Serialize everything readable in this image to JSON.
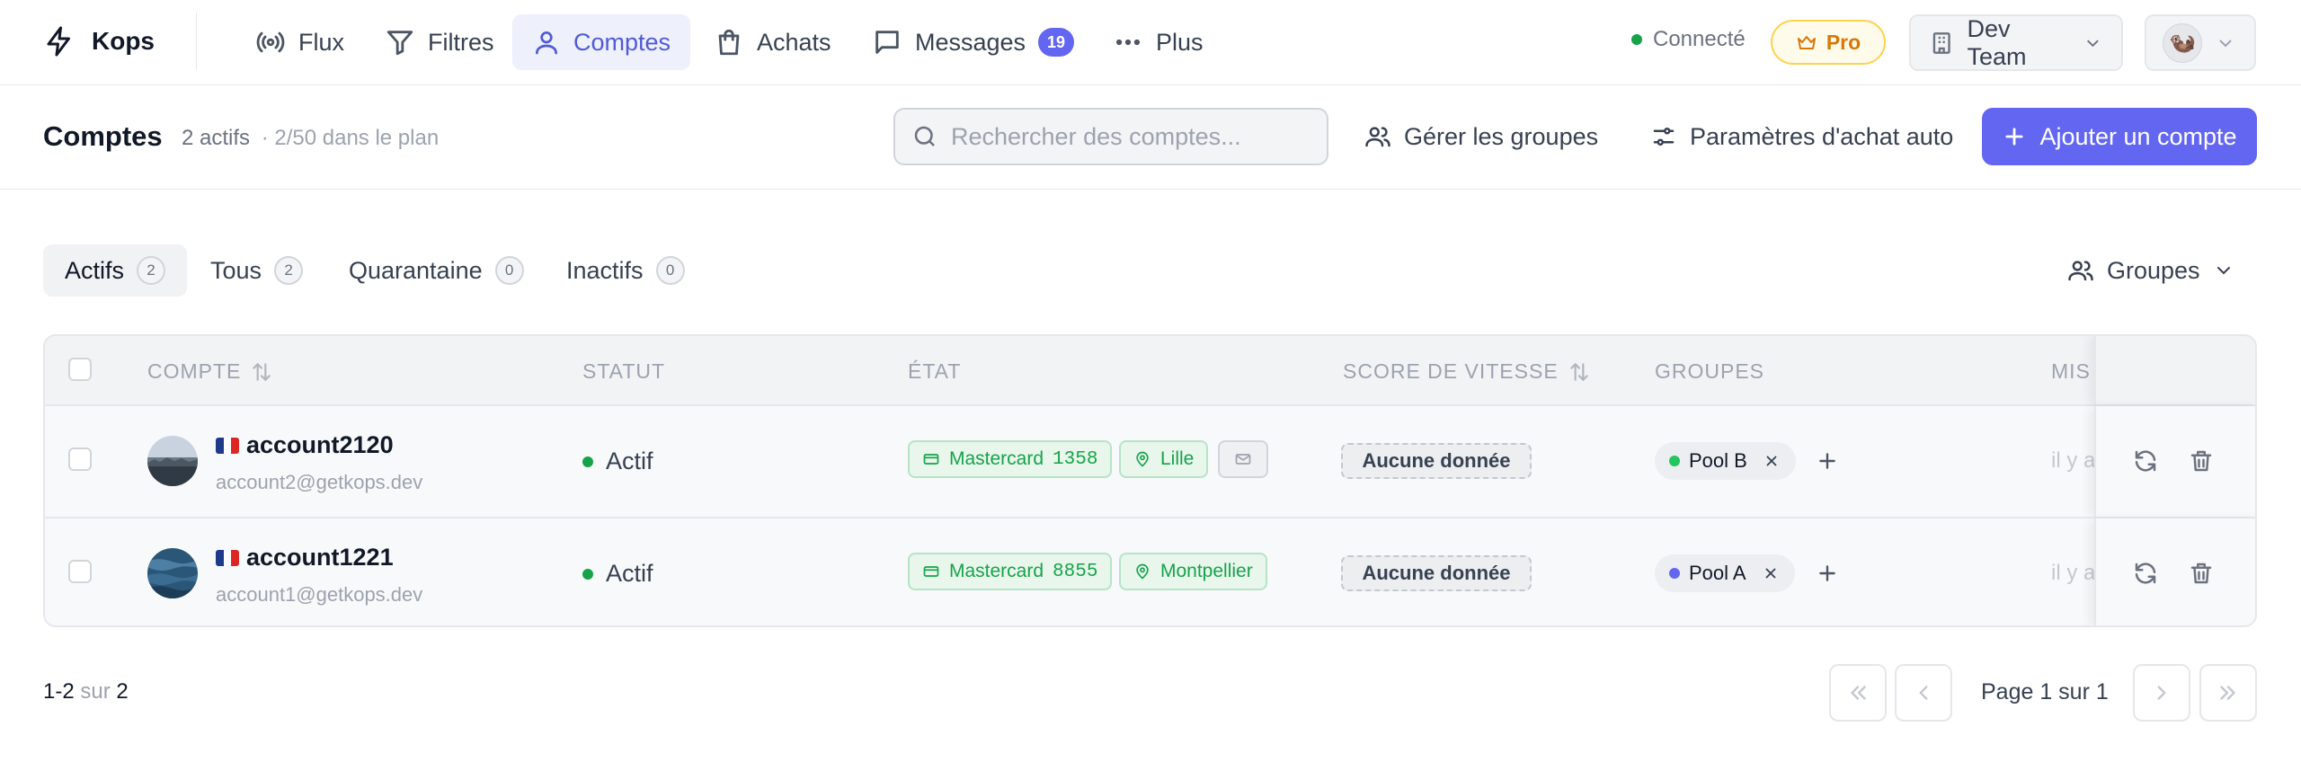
{
  "app": {
    "name": "Kops",
    "logo_icon": "bolt-icon"
  },
  "nav": {
    "items": [
      {
        "label": "Flux",
        "icon": "broadcast-icon"
      },
      {
        "label": "Filtres",
        "icon": "filter-icon"
      },
      {
        "label": "Comptes",
        "icon": "user-icon",
        "active": true
      },
      {
        "label": "Achats",
        "icon": "shopping-bag-icon"
      },
      {
        "label": "Messages",
        "icon": "message-icon",
        "badge": "19"
      },
      {
        "label": "Plus",
        "icon": "more-icon"
      }
    ],
    "status": "Connecté",
    "plan_badge": "Pro",
    "team": "Dev Team",
    "avatar_emoji": "🦦"
  },
  "header": {
    "title": "Comptes",
    "active_count": "2 actifs",
    "plan_usage": "· 2/50 dans le plan",
    "search_placeholder": "Rechercher des comptes...",
    "manage_groups": "Gérer les groupes",
    "auto_purchase": "Paramètres d'achat auto",
    "add_account": "Ajouter un compte"
  },
  "tabs": [
    {
      "label": "Actifs",
      "count": "2",
      "active": true
    },
    {
      "label": "Tous",
      "count": "2"
    },
    {
      "label": "Quarantaine",
      "count": "0"
    },
    {
      "label": "Inactifs",
      "count": "0"
    }
  ],
  "groups_filter": "Groupes",
  "table": {
    "columns": [
      "COMPTE",
      "STATUT",
      "ÉTAT",
      "SCORE DE VITESSE",
      "GROUPES",
      "MIS"
    ],
    "rows": [
      {
        "name": "account2120",
        "email": "account2@getkops.dev",
        "status": "Actif",
        "card": "Mastercard",
        "card_last4": "1358",
        "city": "Lille",
        "has_mail_chip": true,
        "speed": "Aucune donnée",
        "group": "Pool B",
        "group_color": "#22c55e",
        "mis": "il y a"
      },
      {
        "name": "account1221",
        "email": "account1@getkops.dev",
        "status": "Actif",
        "card": "Mastercard",
        "card_last4": "8855",
        "city": "Montpellier",
        "has_mail_chip": false,
        "speed": "Aucune donnée",
        "group": "Pool A",
        "group_color": "#6366f1",
        "mis": "il y a"
      }
    ]
  },
  "pagination": {
    "range": "1-2",
    "of_word": "sur",
    "total": "2",
    "page_label": "Page 1 sur 1"
  },
  "colors": {
    "accent": "#6366f1",
    "success": "#16a34a",
    "pro": "#d97706"
  }
}
